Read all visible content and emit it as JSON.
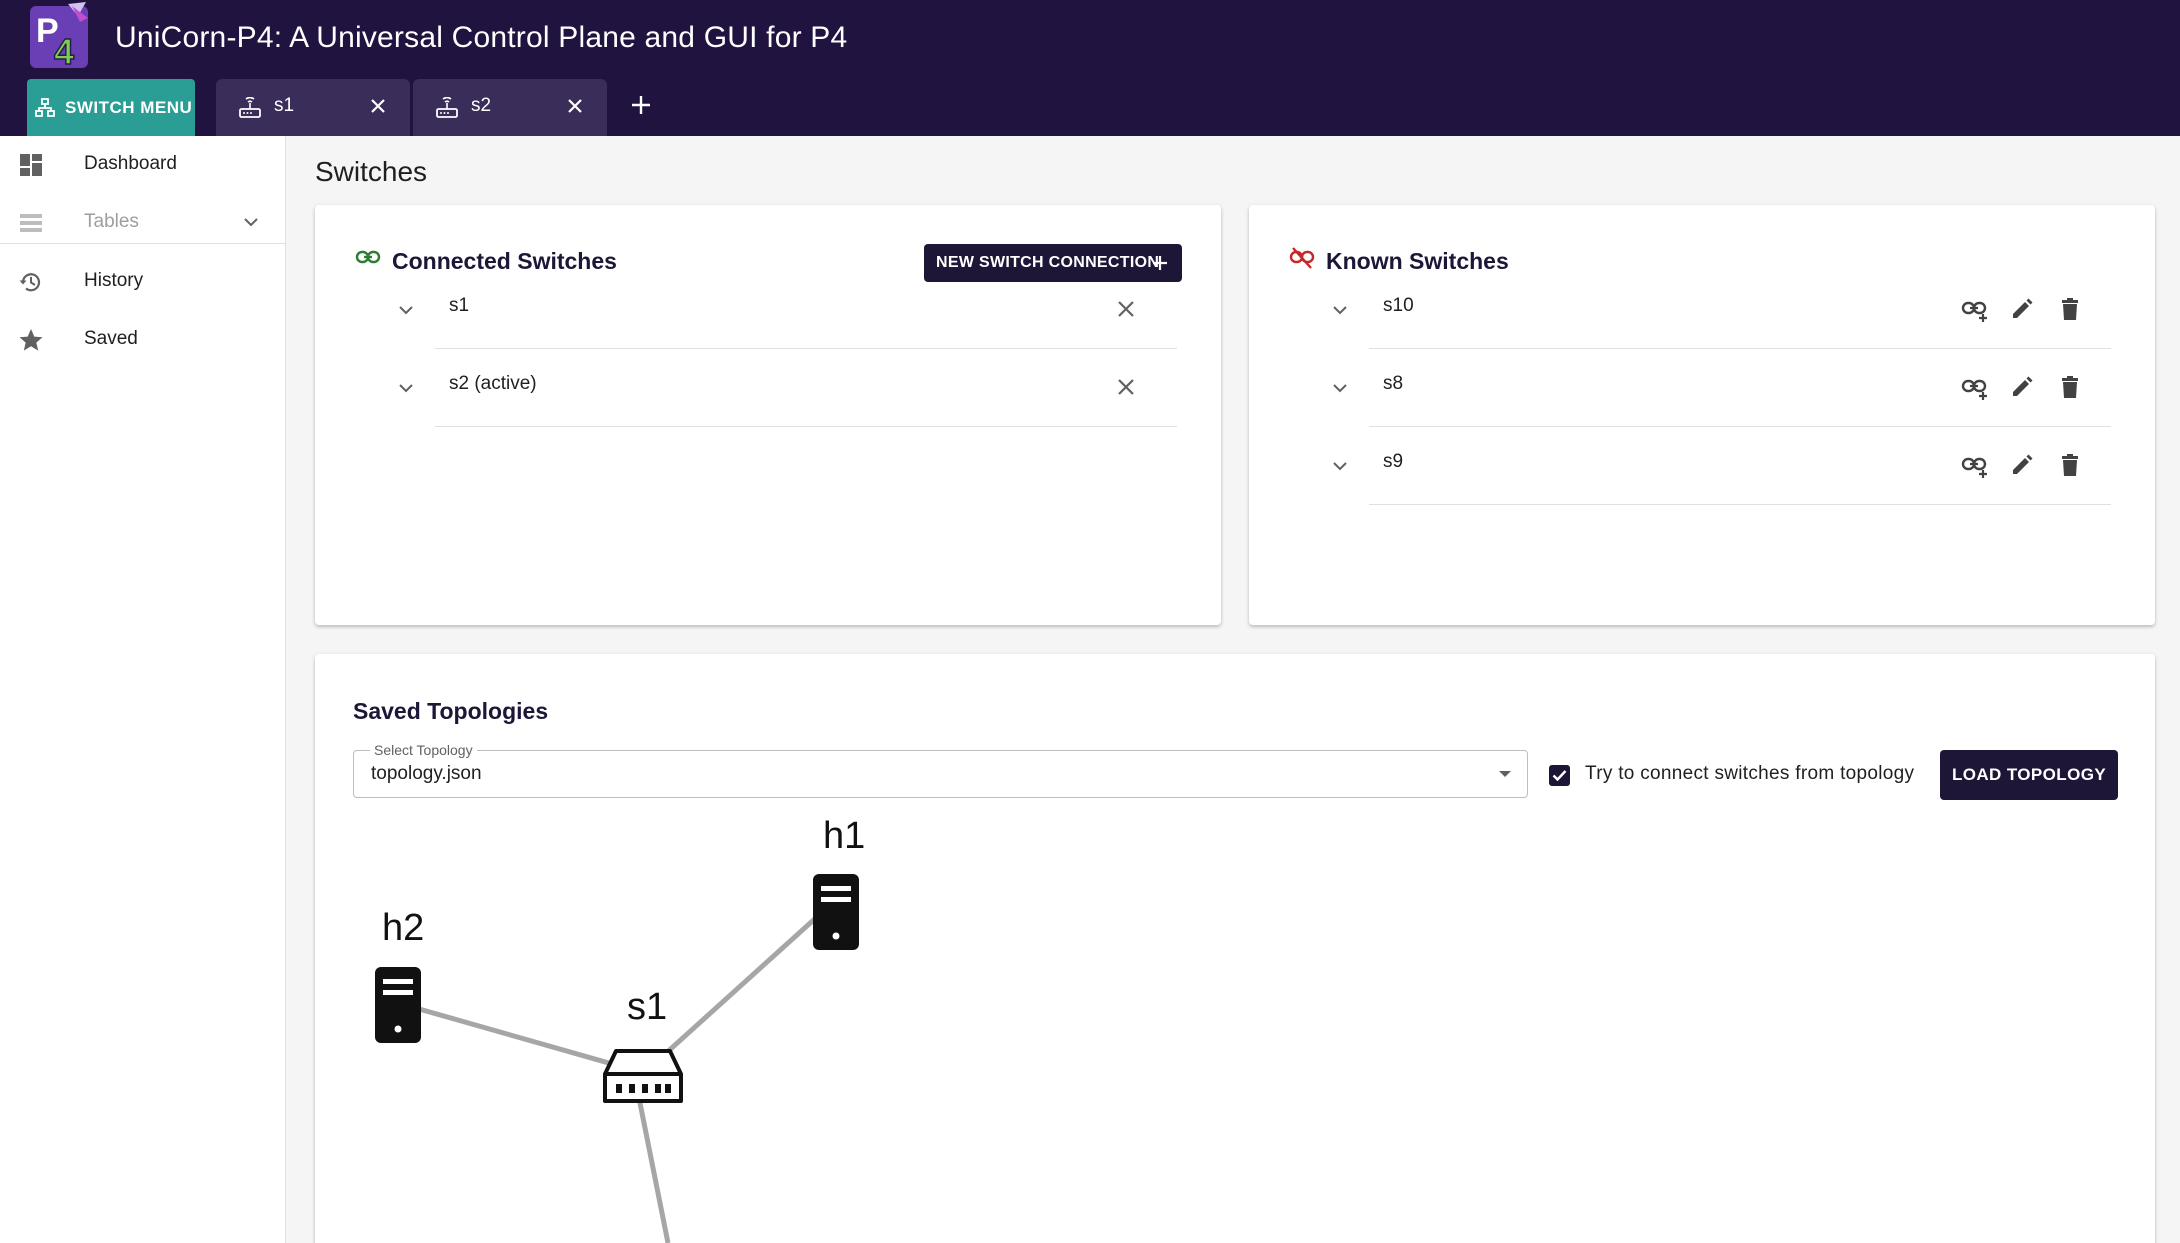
{
  "header": {
    "app_title": "UniCorn-P4: A Universal Control Plane and GUI for P4",
    "logo_text": "P4",
    "switch_menu_label": "SWITCH MENU",
    "tabs": [
      {
        "label": "s1"
      },
      {
        "label": "s2"
      }
    ]
  },
  "sidebar": {
    "items": [
      {
        "label": "Dashboard",
        "icon": "dashboard-icon"
      },
      {
        "label": "Tables",
        "icon": "tables-icon",
        "disabled": true
      },
      {
        "label": "History",
        "icon": "history-icon"
      },
      {
        "label": "Saved",
        "icon": "star-icon"
      }
    ]
  },
  "main": {
    "page_title": "Switches",
    "connected": {
      "title": "Connected Switches",
      "new_button_label": "NEW SWITCH CONNECTION",
      "rows": [
        "s1",
        "s2 (active)"
      ]
    },
    "known": {
      "title": "Known Switches",
      "rows": [
        "s10",
        "s8",
        "s9"
      ]
    },
    "topologies": {
      "title": "Saved Topologies",
      "select_label": "Select Topology",
      "select_value": "topology.json",
      "checkbox_label": "Try to connect switches from topology",
      "checkbox_checked": true,
      "load_button_label": "LOAD TOPOLOGY",
      "nodes": {
        "h1": "h1",
        "h2": "h2",
        "s1": "s1"
      }
    }
  },
  "colors": {
    "appbar": "#21133f",
    "accent_teal": "#2a9d94",
    "primary_dark": "#1d1637",
    "connected_icon": "#2e7d32",
    "disconnected_icon": "#c62828"
  }
}
